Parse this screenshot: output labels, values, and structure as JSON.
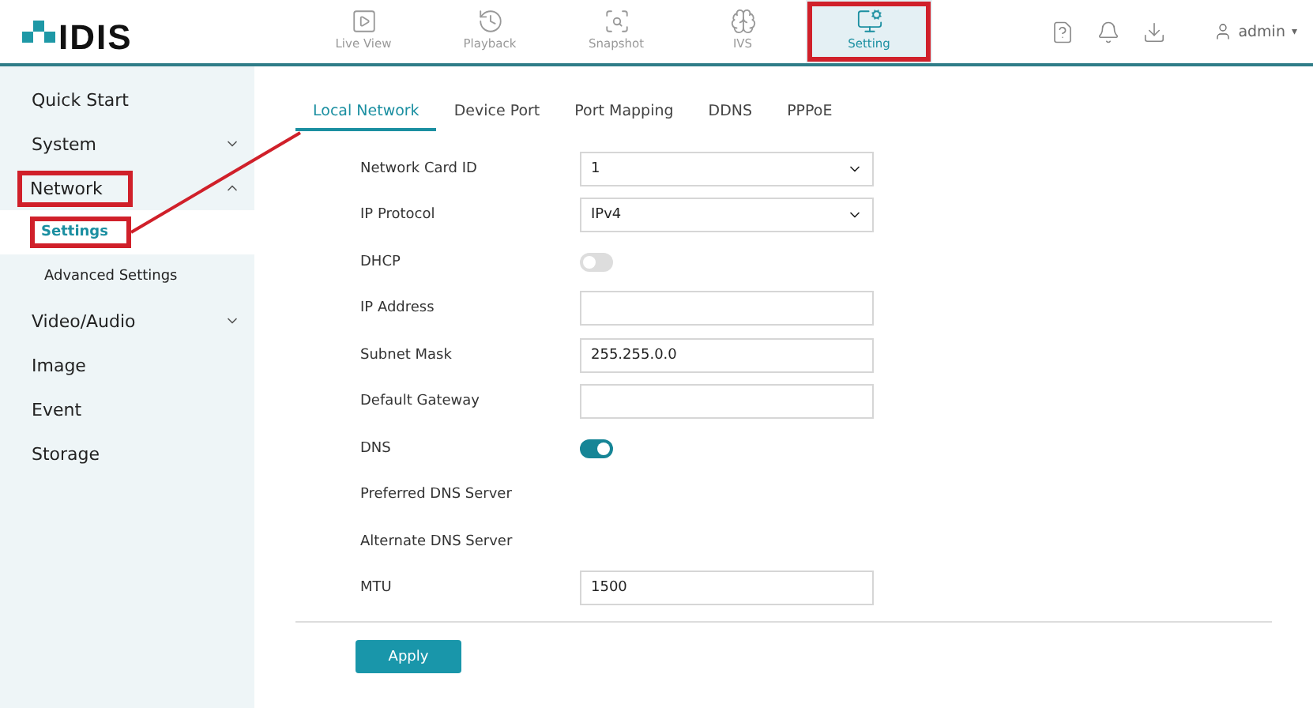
{
  "logo": {
    "text": "IDIS"
  },
  "nav": [
    {
      "label": "Live View",
      "selected": false,
      "annotated": false
    },
    {
      "label": "Playback",
      "selected": false,
      "annotated": false
    },
    {
      "label": "Snapshot",
      "selected": false,
      "annotated": false
    },
    {
      "label": "IVS",
      "selected": false,
      "annotated": false
    },
    {
      "label": "Setting",
      "selected": true,
      "annotated": true
    }
  ],
  "user": {
    "name": "admin",
    "caret": "▾"
  },
  "sidebar": {
    "items": [
      {
        "label": "Quick Start",
        "annotated": false
      },
      {
        "label": "System",
        "expanded": false,
        "annotated": false
      },
      {
        "label": "Network",
        "expanded": true,
        "annotated": true,
        "children": [
          {
            "label": "Settings",
            "selected": true,
            "annotated": true
          },
          {
            "label": "Advanced Settings",
            "selected": false,
            "annotated": false
          }
        ]
      },
      {
        "label": "Video/Audio",
        "expanded": false,
        "annotated": false
      },
      {
        "label": "Image",
        "annotated": false
      },
      {
        "label": "Event",
        "annotated": false
      },
      {
        "label": "Storage",
        "annotated": false
      }
    ]
  },
  "tabs": [
    {
      "label": "Local Network",
      "selected": true
    },
    {
      "label": "Device Port",
      "selected": false
    },
    {
      "label": "Port Mapping",
      "selected": false
    },
    {
      "label": "DDNS",
      "selected": false
    },
    {
      "label": "PPPoE",
      "selected": false
    }
  ],
  "form": [
    {
      "label": "Network Card ID",
      "kind": "select",
      "value": "1"
    },
    {
      "label": "IP Protocol",
      "kind": "select",
      "value": "IPv4"
    },
    {
      "label": "DHCP",
      "kind": "toggle",
      "on": false
    },
    {
      "label": "IP Address",
      "kind": "input"
    },
    {
      "label": "Subnet Mask",
      "kind": "input",
      "value": "255.255.0.0"
    },
    {
      "label": "Default Gateway",
      "kind": "input"
    },
    {
      "label": "DNS",
      "kind": "toggle",
      "on": true
    },
    {
      "label": "Preferred DNS Server",
      "kind": "text"
    },
    {
      "label": "Alternate DNS Server",
      "kind": "text"
    },
    {
      "label": "MTU",
      "kind": "input",
      "value": "1500"
    }
  ],
  "apply_button": "Apply"
}
